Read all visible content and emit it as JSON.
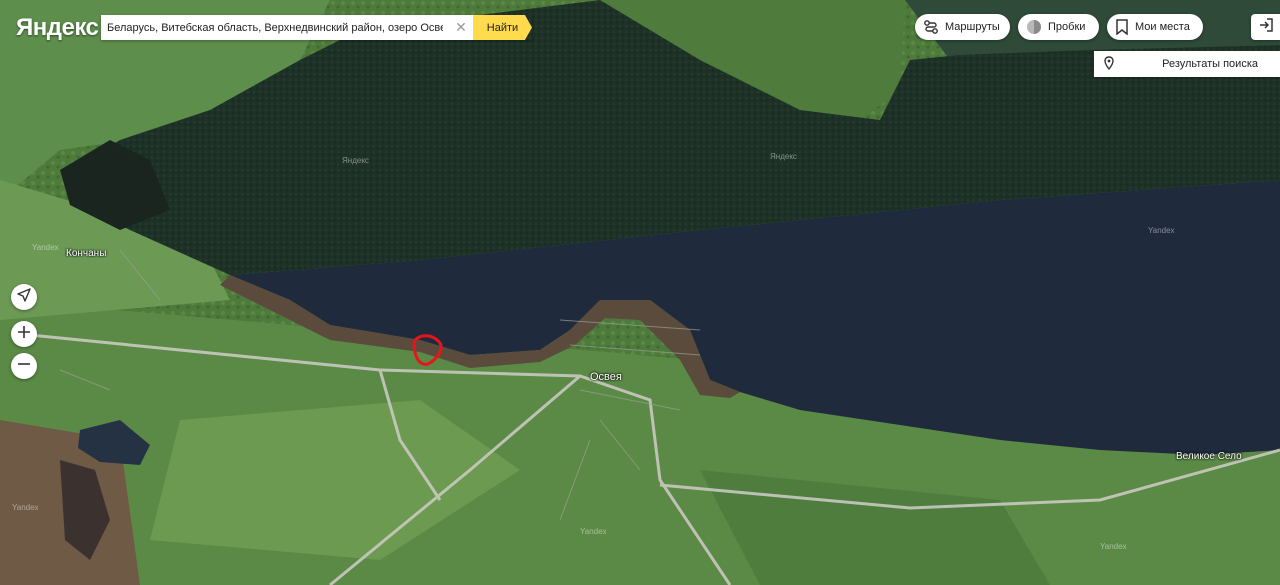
{
  "header": {
    "logo": "Яндекс",
    "search": {
      "value": "Беларусь, Витебская область, Верхнедвинский район, озеро Освейск",
      "button_label": "Найти"
    },
    "routes_label": "Маршруты",
    "traffic_label": "Пробки",
    "places_label": "Мои места",
    "results_label": "Результаты поиска"
  },
  "map": {
    "places": {
      "konchany": "Кончаны",
      "osveya": "Освея",
      "velikoe_selo": "Великое Село"
    },
    "watermarks": [
      "Яндекс",
      "Яндекс",
      "Yandex",
      "Yandex",
      "Yandex",
      "Yandex",
      "Yandex"
    ],
    "marked_area_color": "#e8141b",
    "lake_color": "#1e2a3a",
    "forest_color": "#1f3328"
  },
  "icons": {
    "routes": "route-icon",
    "traffic": "traffic-icon",
    "places": "bookmark-icon",
    "exit": "logout-icon",
    "results": "pin-icon",
    "locate": "locate-arrow-icon",
    "zoom_in": "plus-icon",
    "zoom_out": "minus-icon"
  }
}
